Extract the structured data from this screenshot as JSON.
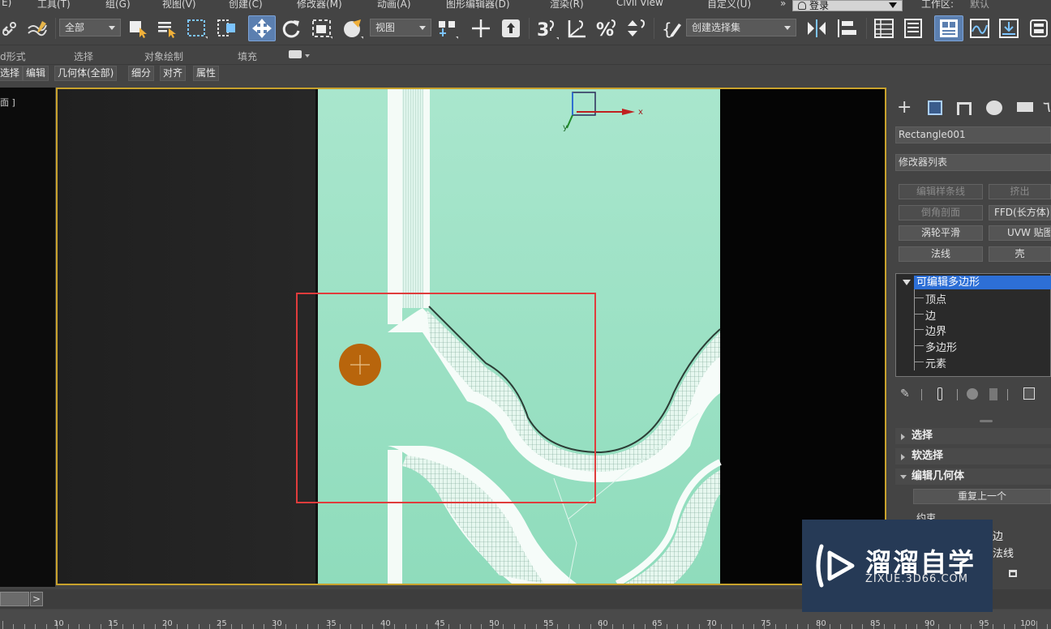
{
  "menubar": {
    "items": [
      "E)",
      "工具(T)",
      "组(G)",
      "视图(V)",
      "创建(C)",
      "修改器(M)",
      "动画(A)",
      "图形编辑器(D)",
      "渲染(R)",
      "Civil View",
      "自定义(U)"
    ],
    "more": "»",
    "login": "登录",
    "workspace_label": "工作区:",
    "workspace_value": "默认"
  },
  "toolbar": {
    "filter_dropdown": "全部",
    "refcoord_dropdown": "视图",
    "selection_set_dropdown": "创建选择集"
  },
  "ribbon": {
    "tabs": [
      "d形式",
      "选择",
      "对象绘制",
      "填充"
    ],
    "sub_items": [
      "选择",
      "编辑",
      "几何体(全部)",
      "细分",
      "对齐",
      "属性"
    ]
  },
  "viewport": {
    "label": "面 ]",
    "gizmo_x": "x",
    "gizmo_y": "y"
  },
  "panel": {
    "object_name": "Rectangle001",
    "modifier_list": "修改器列表",
    "buttons": [
      {
        "label": "编辑样条线",
        "enabled": false
      },
      {
        "label": "挤出",
        "enabled": false
      },
      {
        "label": "倒角剖面",
        "enabled": false
      },
      {
        "label": "FFD(长方体)",
        "enabled": true
      },
      {
        "label": "涡轮平滑",
        "enabled": true
      },
      {
        "label": "UVW 贴图",
        "enabled": true
      },
      {
        "label": "法线",
        "enabled": true
      },
      {
        "label": "壳",
        "enabled": true
      }
    ],
    "stack_selected": "可编辑多边形",
    "stack_subs": [
      "顶点",
      "边",
      "边界",
      "多边形",
      "元素"
    ],
    "rollouts": [
      "选择",
      "软选择",
      "编辑几何体"
    ],
    "repeat_last": "重复上一个",
    "constraint_label": "约束",
    "constraint_edge": "边",
    "constraint_normal": "法线"
  },
  "timeline": {
    "ticks": [
      "10",
      "15",
      "20",
      "25",
      "30",
      "35",
      "40",
      "45",
      "50",
      "55",
      "60",
      "65",
      "70",
      "75",
      "80",
      "85",
      "90",
      "95",
      "100"
    ]
  },
  "watermark": {
    "title": "溜溜自学",
    "url": "ZIXUE.3D66.COM"
  },
  "colors": {
    "viewport_border": "#c8a22c",
    "mesh_fill": "#a8e6cc",
    "selection_rect": "#e03c3c",
    "brush_cursor": "#b8650c",
    "highlight": "#2d6fd6"
  }
}
